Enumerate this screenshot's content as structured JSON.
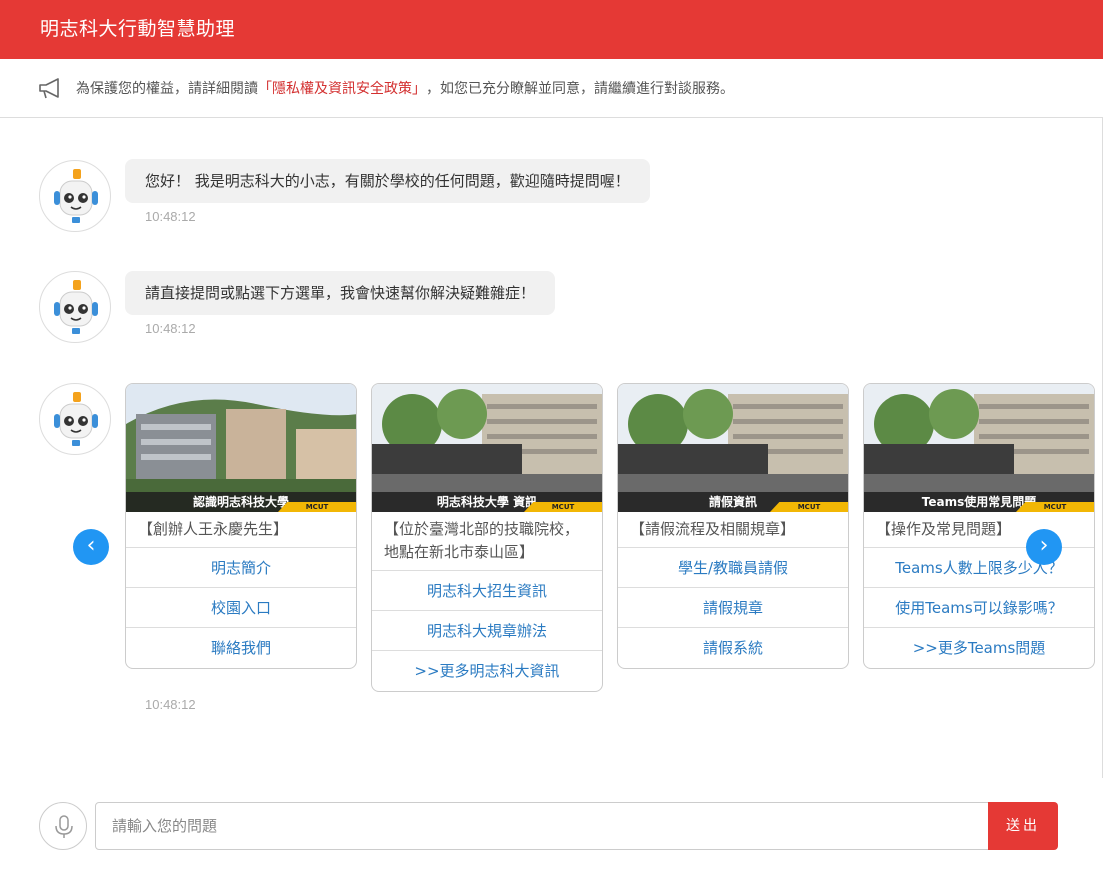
{
  "header": {
    "title": "明志科大行動智慧助理"
  },
  "notice": {
    "prefix": "為保護您的權益，請詳細閱讀",
    "policy_link": "「隱私權及資訊安全政策」",
    "suffix": "，如您已充分瞭解並同意，請繼續進行對談服務。",
    "icon": "megaphone-icon"
  },
  "messages": [
    {
      "text": "您好！ 我是明志科大的小志，有關於學校的任何問題，歡迎隨時提問喔！",
      "time": "10:48:12"
    },
    {
      "text": "請直接提問或點選下方選單，我會快速幫你解決疑難雜症！",
      "time": "10:48:12"
    }
  ],
  "carousel": {
    "time": "10:48:12",
    "cards": [
      {
        "band": "認識明志科技大學",
        "badge": "MCUT",
        "subtitle": "【創辦人王永慶先生】",
        "links": [
          "明志簡介",
          "校園入口",
          "聯絡我們"
        ]
      },
      {
        "band": "明志科技大學 資訊",
        "badge": "MCUT",
        "subtitle": "【位於臺灣北部的技職院校，地點在新北市泰山區】",
        "links": [
          "明志科大招生資訊",
          "明志科大規章辦法",
          ">>更多明志科大資訊"
        ]
      },
      {
        "band": "請假資訊",
        "badge": "MCUT",
        "subtitle": "【請假流程及相關規章】",
        "links": [
          "學生/教職員請假",
          "請假規章",
          "請假系統"
        ]
      },
      {
        "band": "Teams使用常見問題",
        "badge": "MCUT",
        "subtitle": "【操作及常見問題】",
        "links": [
          "Teams人數上限多少人？",
          "使用Teams可以錄影嗎？",
          ">>更多Teams問題"
        ]
      }
    ]
  },
  "nav": {
    "prev": "‹",
    "next": "›"
  },
  "input": {
    "placeholder": "請輸入您的問題",
    "send_label": "送出"
  },
  "colors": {
    "brand": "#e53935",
    "link": "#2b7bc2",
    "nav": "#2196f3"
  }
}
